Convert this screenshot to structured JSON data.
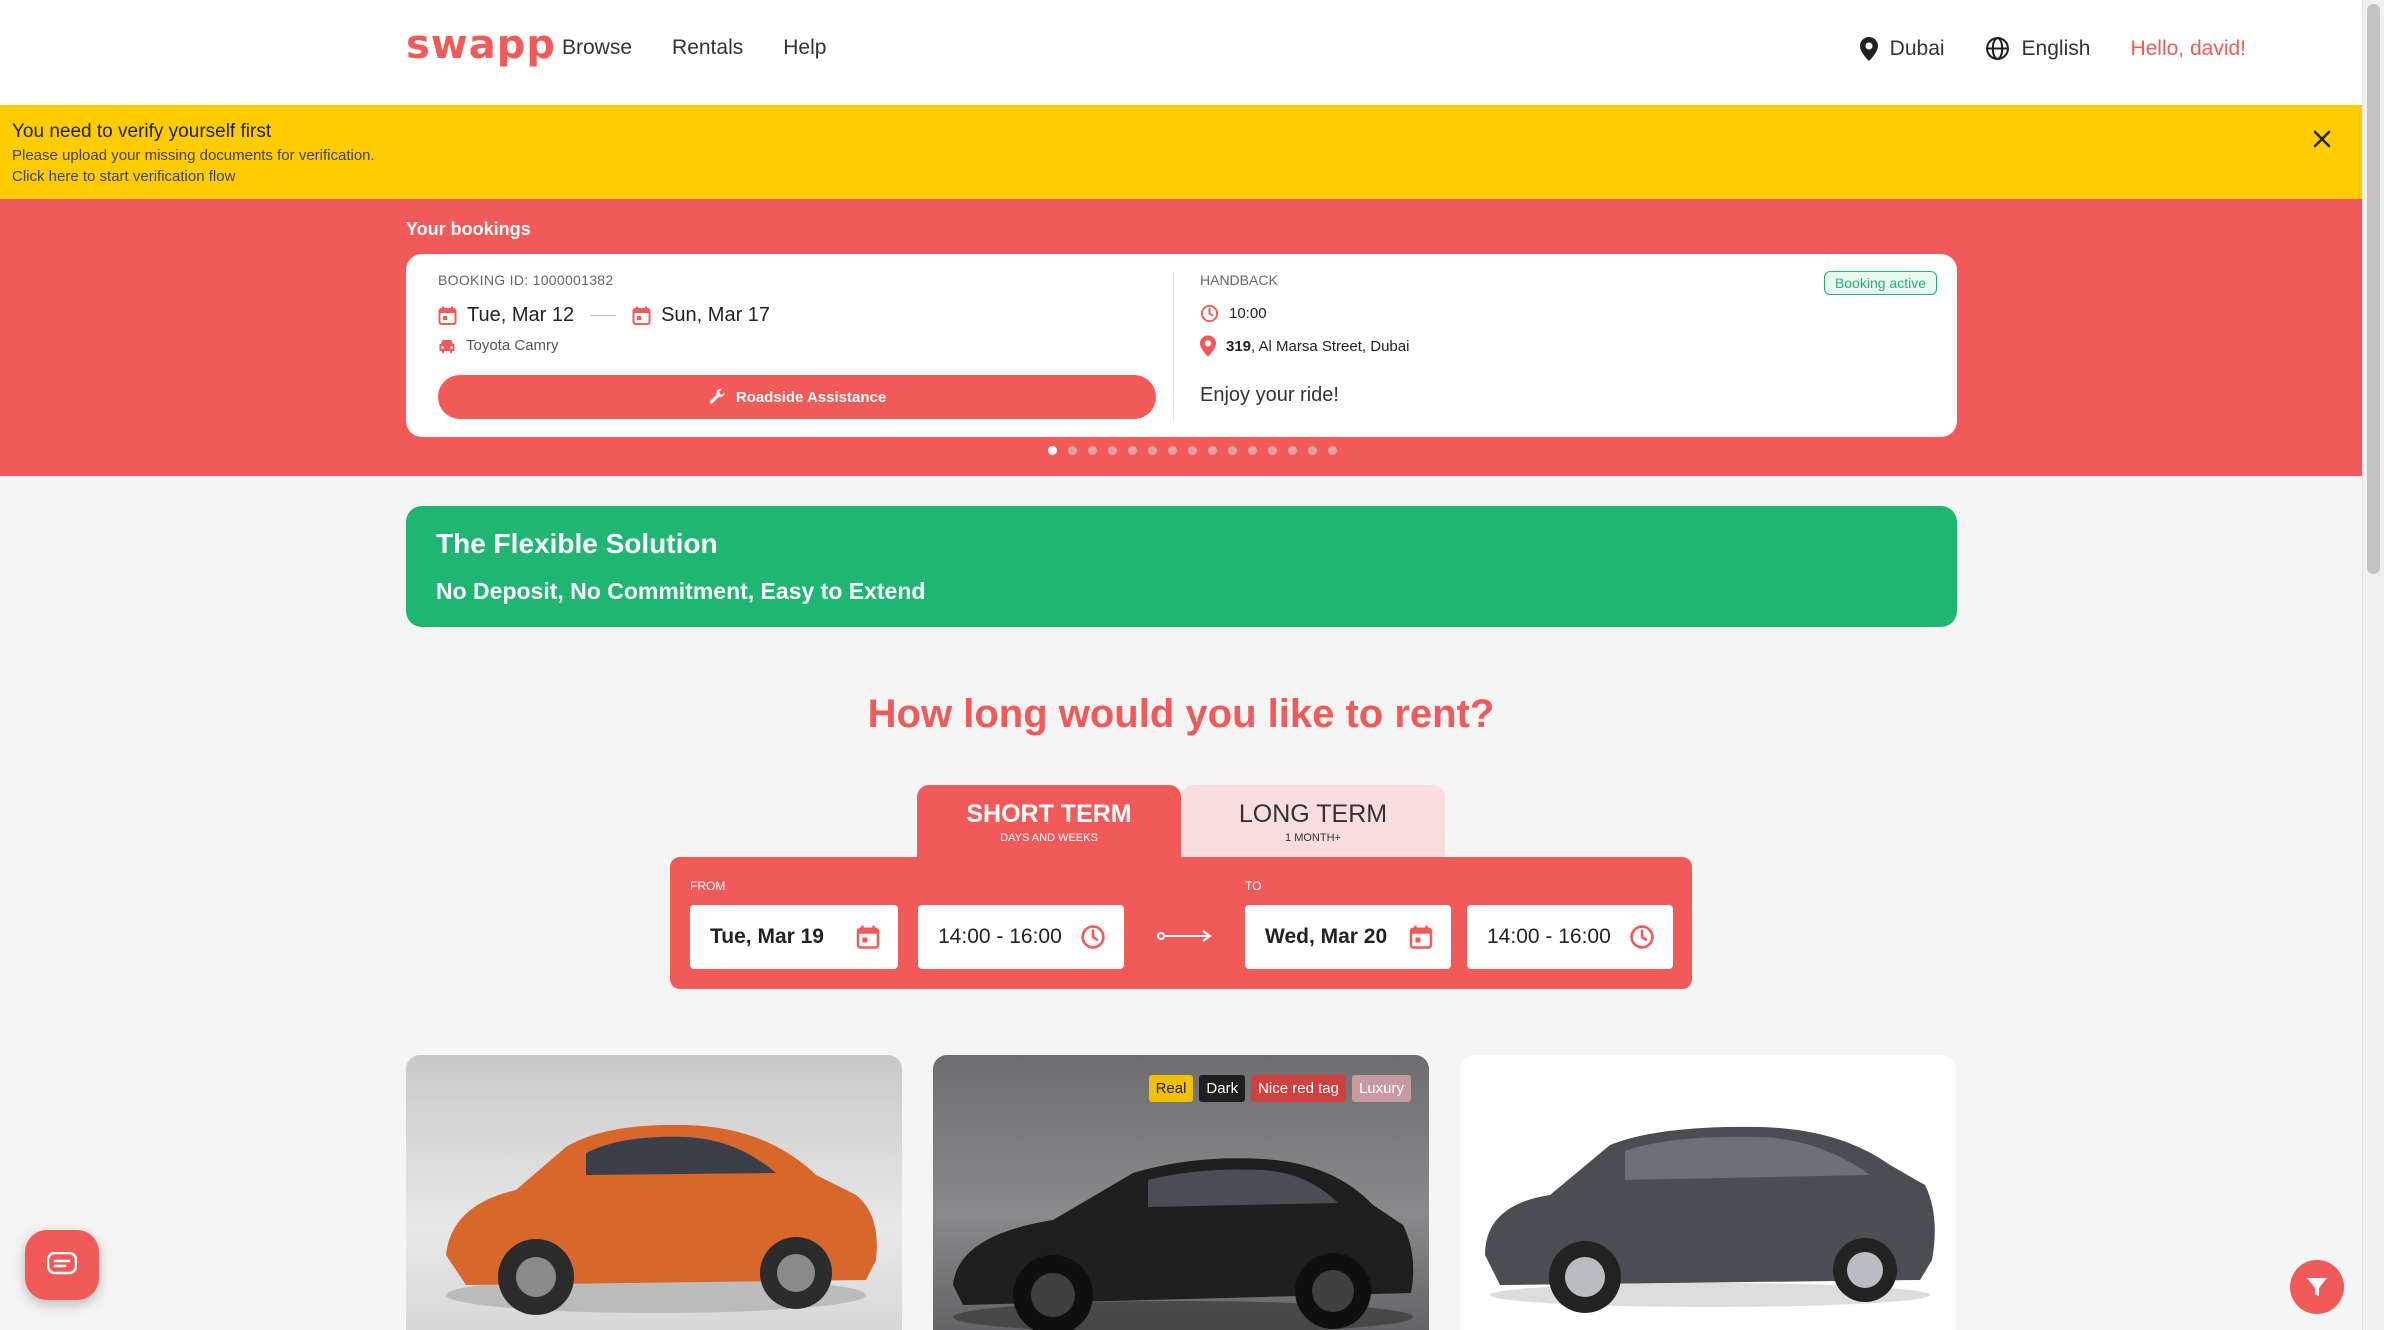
{
  "header": {
    "logo": "swapp",
    "nav": [
      "Browse",
      "Rentals",
      "Help"
    ],
    "location": "Dubai",
    "language": "English",
    "greeting": "Hello, david!"
  },
  "verify_banner": {
    "title": "You need to verify yourself first",
    "line1": "Please upload your missing documents for verification.",
    "line2": "Click here to start verification flow"
  },
  "bookings": {
    "section_title": "Your bookings",
    "booking_id": "BOOKING ID: 1000001382",
    "start_date": "Tue, Mar 12",
    "end_date": "Sun, Mar 17",
    "car": "Toyota Camry",
    "roadside_label": "Roadside Assistance",
    "handback_label": "HANDBACK",
    "handback_time": "10:00",
    "handback_number": "319",
    "handback_street": ", Al Marsa Street, Dubai",
    "status": "Booking active",
    "message": "Enjoy your ride!",
    "carousel_total": 15,
    "carousel_active": 1
  },
  "promo": {
    "title": "The Flexible Solution",
    "subtitle": "No Deposit, No Commitment, Easy to Extend"
  },
  "rent": {
    "question": "How long would you like to rent?",
    "tabs": [
      {
        "label": "SHORT TERM",
        "sub": "DAYS AND WEEKS"
      },
      {
        "label": "LONG TERM",
        "sub": "1 MONTH+"
      }
    ],
    "from_label": "FROM",
    "to_label": "TO",
    "from_date": "Tue, Mar 19",
    "from_time": "14:00 - 16:00",
    "to_date": "Wed, Mar 20",
    "to_time": "14:00 - 16:00"
  },
  "cars": [
    {
      "name": "orange-hatchback",
      "color": "#d9662a",
      "tags": []
    },
    {
      "name": "black-sports-coupe",
      "color": "#1e1e1f",
      "tags": [
        {
          "label": "Real",
          "color": "#f2c200",
          "text": "#222222"
        },
        {
          "label": "Dark",
          "color": "#1f1f1f",
          "text": "#ffffff"
        },
        {
          "label": "Nice red tag",
          "color": "#d0403f",
          "text": "#ffffff"
        },
        {
          "label": "Luxury",
          "color": "#c89aa0",
          "text": "#ffffff"
        }
      ]
    },
    {
      "name": "grey-sedan",
      "color": "#4a4d52",
      "tags": []
    }
  ],
  "colors": {
    "brand": "#f25a5a",
    "green": "#1fb573",
    "yellow": "#ffcc00"
  }
}
